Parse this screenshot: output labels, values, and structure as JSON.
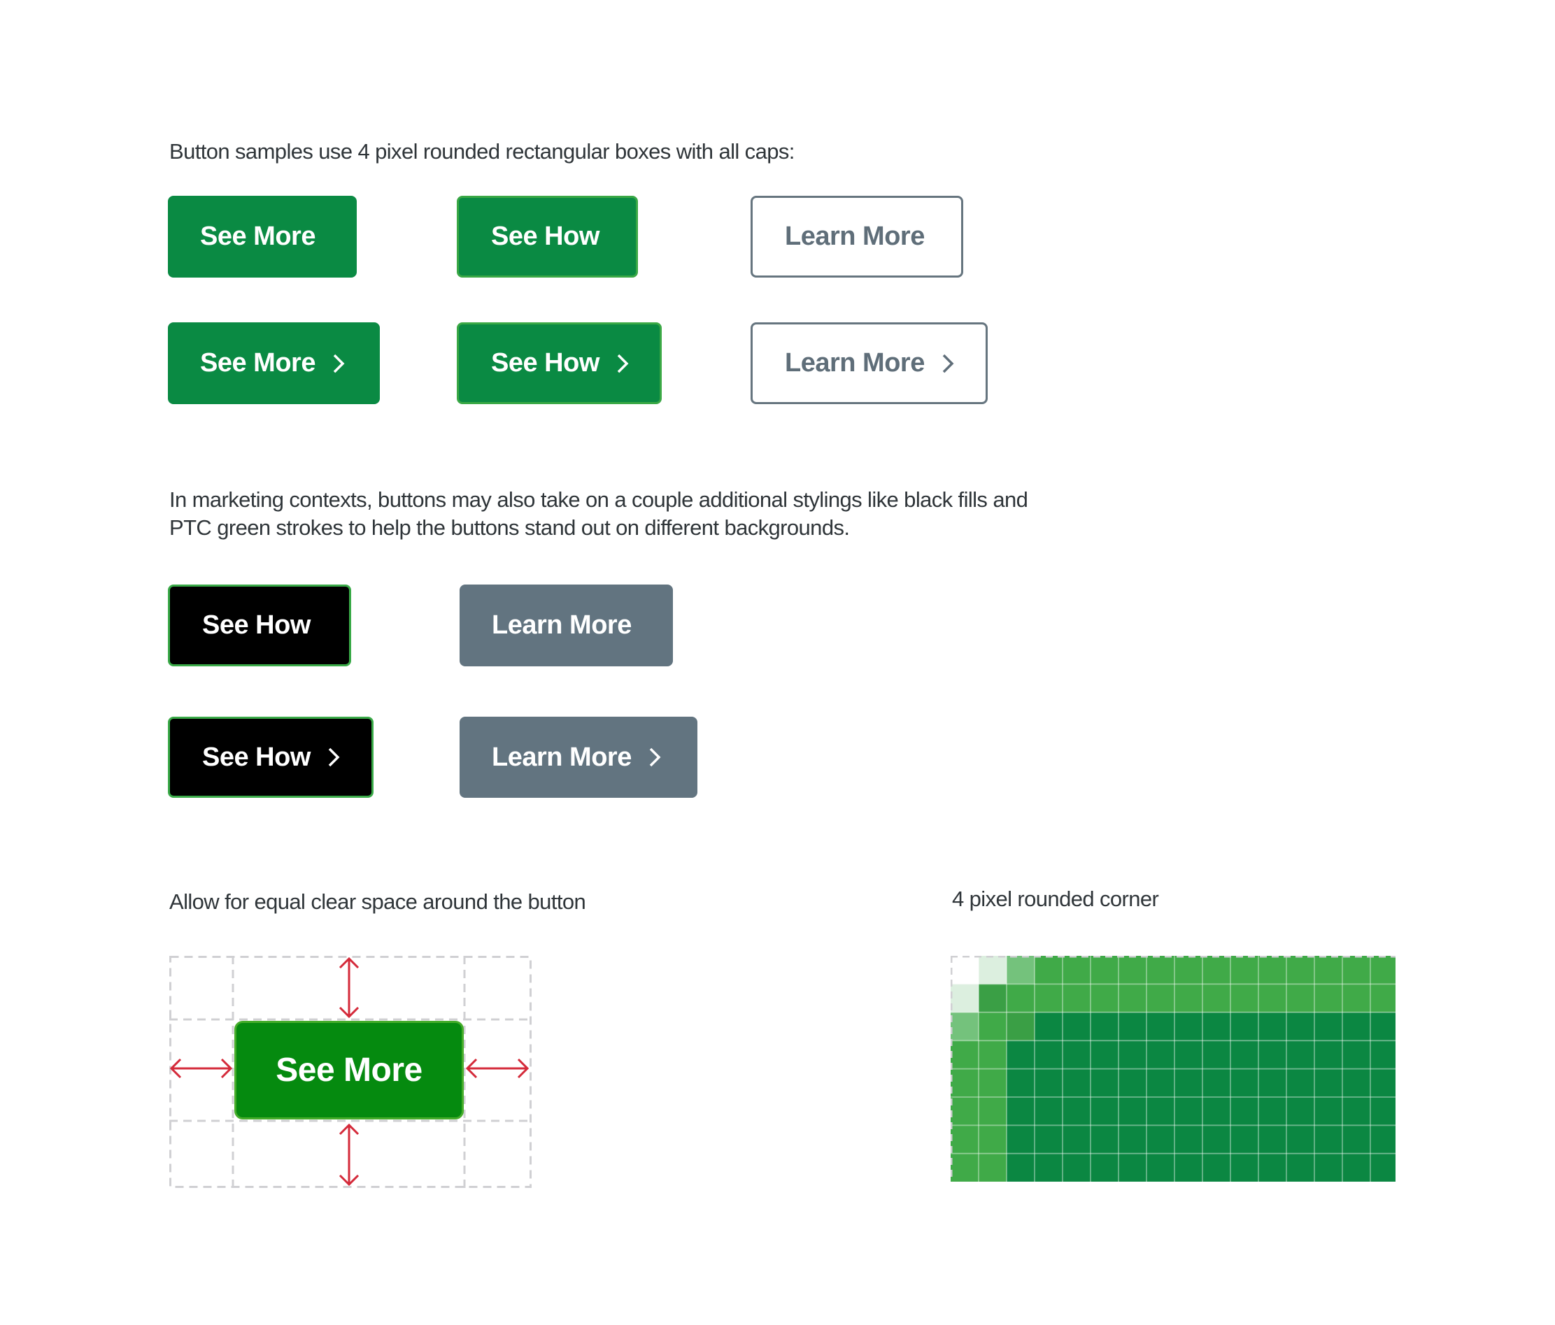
{
  "intro_text": "Button samples use 4 pixel rounded rectangular boxes with all caps:",
  "standard_buttons": {
    "row1": [
      {
        "label": "See More",
        "style": "green-fill"
      },
      {
        "label": "See How",
        "style": "green-fill-green-stroke"
      },
      {
        "label": "Learn More",
        "style": "outline-gray"
      }
    ],
    "row2": [
      {
        "label": "See More",
        "style": "green-fill",
        "icon": "chevron-right-icon"
      },
      {
        "label": "See How",
        "style": "green-fill-green-stroke",
        "icon": "chevron-right-icon"
      },
      {
        "label": "Learn More",
        "style": "outline-gray",
        "icon": "chevron-right-icon"
      }
    ]
  },
  "marketing_text": {
    "line1": "In marketing contexts, buttons may also take on a couple additional stylings like black fills and",
    "line2": "PTC green strokes to help the buttons stand out on different backgrounds."
  },
  "marketing_buttons": {
    "row1": [
      {
        "label": "See How",
        "style": "black-fill-green-stroke"
      },
      {
        "label": "Learn More",
        "style": "gray-fill"
      }
    ],
    "row2": [
      {
        "label": "See How",
        "style": "black-fill-green-stroke",
        "icon": "chevron-right-icon"
      },
      {
        "label": "Learn More",
        "style": "gray-fill",
        "icon": "chevron-right-icon"
      }
    ]
  },
  "clear_space": {
    "caption": "Allow for equal clear space around the button",
    "button_label": "See More"
  },
  "rounded_corner": {
    "caption": "4 pixel rounded corner",
    "columns": 16,
    "rows": 8
  },
  "colors": {
    "ptc_green": "#0a8a43",
    "green_stroke": "#3aa845",
    "outline_gray": "#66757f",
    "gray_fill": "#627480",
    "black_fill": "#000000",
    "arrow_red": "#d42a3a",
    "guide_dash": "#d0d0d3",
    "demo_green": "#058a0f"
  }
}
